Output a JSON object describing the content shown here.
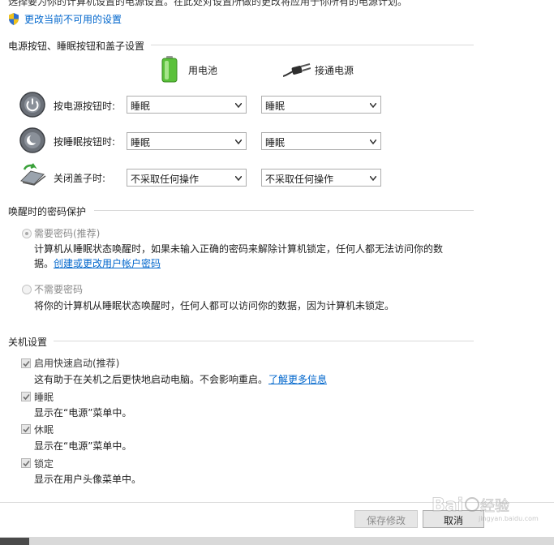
{
  "header": {
    "intro_text": "选择要为你的计算机设置的电源设置。在此处对设置所做的更改将应用于你所有的电源计划。",
    "change_link": "更改当前不可用的设置"
  },
  "buttons_section": {
    "title": "电源按钮、睡眠按钮和盖子设置",
    "col_battery": "用电池",
    "col_plugged": "接通电源",
    "rows": [
      {
        "label": "按电源按钮时:",
        "battery": "睡眠",
        "plugged": "睡眠"
      },
      {
        "label": "按睡眠按钮时:",
        "battery": "睡眠",
        "plugged": "睡眠"
      },
      {
        "label": "关闭盖子时:",
        "battery": "不采取任何操作",
        "plugged": "不采取任何操作"
      }
    ]
  },
  "password_section": {
    "title": "唤醒时的密码保护",
    "require": {
      "label": "需要密码(推荐)",
      "desc_line1": "计算机从睡眠状态唤醒时，如果未输入正确的密码来解除计算机锁定，任何人都无法访问你的数",
      "desc_line2": "据。",
      "link": "创建或更改用户帐户密码"
    },
    "no_require": {
      "label": "不需要密码",
      "desc": "将你的计算机从睡眠状态唤醒时，任何人都可以访问你的数据，因为计算机未锁定。"
    }
  },
  "shutdown_section": {
    "title": "关机设置",
    "items": [
      {
        "label": "启用快速启动(推荐)",
        "desc": "这有助于在关机之后更快地启动电脑。不会影响重启。",
        "link": "了解更多信息",
        "checked": true
      },
      {
        "label": "睡眠",
        "desc": "显示在“电源”菜单中。",
        "checked": true
      },
      {
        "label": "休眠",
        "desc": "显示在“电源”菜单中。",
        "checked": true
      },
      {
        "label": "锁定",
        "desc": "显示在用户头像菜单中。",
        "checked": true
      }
    ]
  },
  "footer": {
    "save_label": "保存修改",
    "cancel_label": "取消"
  },
  "watermark": {
    "text": "Baidu 经验",
    "sub": "jingyan.baidu.com"
  },
  "colors": {
    "link": "#0066cc",
    "battery_green": "#4caf2a",
    "section_line": "#d8d8d8"
  }
}
